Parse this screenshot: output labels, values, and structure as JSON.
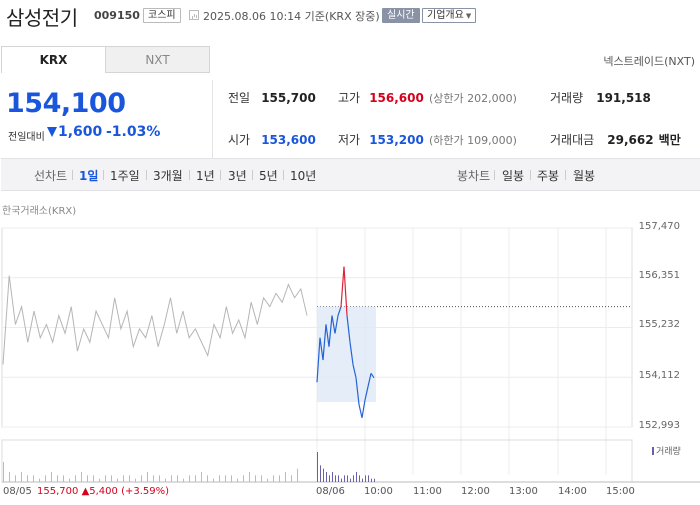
{
  "header": {
    "stock_name": "삼성전기",
    "stock_code": "009150",
    "market_badge": "코스피",
    "timestamp": "2025.08.06 10:14 기준(KRX 장중)",
    "realtime_badge": "실시간",
    "company_button": "기업개요"
  },
  "tabs": {
    "krx": "KRX",
    "nxt": "NXT"
  },
  "nxt_link": "넥스트레이드(NXT)",
  "price": {
    "current": "154,100",
    "change_label": "전일대비",
    "change_value": "1,600",
    "change_percent": "-1.03%"
  },
  "stats": {
    "prev_close_label": "전일",
    "prev_close": "155,700",
    "high_label": "고가",
    "high": "156,600",
    "upper_limit": "(상한가 202,000)",
    "volume_label": "거래량",
    "volume": "191,518",
    "open_label": "시가",
    "open": "153,600",
    "low_label": "저가",
    "low": "153,200",
    "lower_limit": "(하한가 109,000)",
    "trade_value_label": "거래대금",
    "trade_value": "29,662",
    "trade_value_unit": "백만"
  },
  "period_bar": {
    "line_label": "선차트",
    "line_periods": [
      "1일",
      "1주일",
      "3개월",
      "1년",
      "3년",
      "5년",
      "10년"
    ],
    "active": "1일",
    "candle_label": "봉차트",
    "candle_periods": [
      "일봉",
      "주봉",
      "월봉"
    ]
  },
  "chart_source": "한국거래소(KRX)",
  "volume_legend": "거래량",
  "footer": {
    "prev_date": "08/05",
    "prev_price": "155,700",
    "prev_change": "5,400",
    "prev_change_pct": "(+3.59%)"
  },
  "chart_data": {
    "type": "line",
    "y_ticks": [
      "157,470",
      "156,351",
      "155,232",
      "154,112",
      "152,993"
    ],
    "ylim": [
      152993,
      157470
    ],
    "x_labels": [
      "08/05",
      "08/06",
      "10:00",
      "11:00",
      "12:00",
      "13:00",
      "14:00",
      "15:00"
    ],
    "reference_price": 155700,
    "series": [
      {
        "values": [
          154400,
          156400,
          155300,
          155700,
          154900,
          155600,
          155000,
          155300,
          154900,
          155500,
          155100,
          155700,
          154700,
          155200,
          154900,
          155600,
          155300,
          155000,
          155900,
          155200,
          155600,
          154800,
          155200,
          155000,
          155500,
          154800,
          155300,
          155900,
          155100,
          155600,
          155000,
          155200,
          154900,
          154600,
          155300,
          155000,
          155700,
          155100,
          155400,
          155000,
          155800,
          155300,
          155900,
          155700,
          156000,
          155800,
          156200,
          155900,
          156100,
          155500
        ]
      },
      {
        "values": [
          154000,
          155000,
          154500,
          155300,
          154800,
          155500,
          155100,
          155500,
          155700,
          156600,
          155500,
          154900,
          154400,
          154100,
          153500,
          153200,
          153600,
          153900,
          154200,
          154100
        ]
      }
    ],
    "volume": [
      6,
      3,
      2,
      3,
      2,
      2,
      1,
      2,
      3,
      2,
      2,
      1,
      2,
      3,
      2,
      2,
      1,
      2,
      2,
      1,
      2,
      2,
      1,
      2,
      3,
      2,
      2,
      1,
      2,
      2,
      1,
      2,
      2,
      3,
      2,
      1,
      2,
      2,
      2,
      1,
      2,
      3,
      2,
      2,
      1,
      2,
      2,
      3,
      2,
      4,
      9,
      5,
      4,
      3,
      2,
      3,
      2,
      2,
      1,
      2,
      2,
      1,
      2,
      3,
      2,
      1,
      2,
      2,
      1,
      1
    ]
  }
}
